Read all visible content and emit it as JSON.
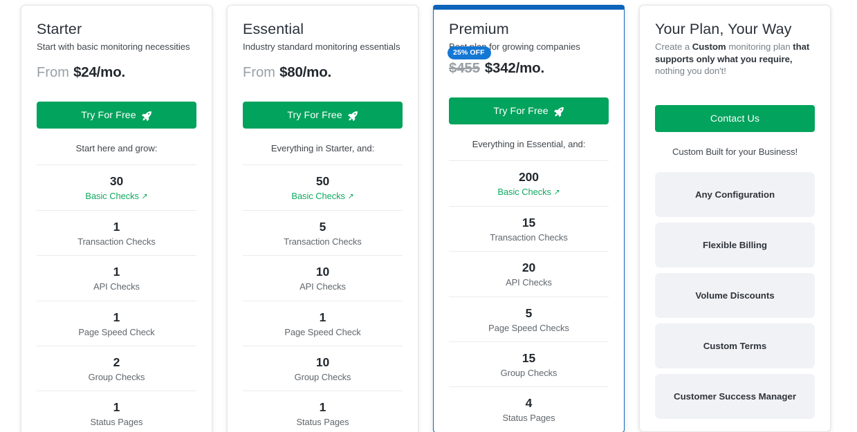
{
  "colors": {
    "cta_green": "#02a35c",
    "link_green": "#0fa960",
    "badge_blue": "#1477d4",
    "featured_border": "#0b63bb",
    "pill_background": "#f1f2f6"
  },
  "plans": [
    {
      "name": "Starter",
      "tagline": "Start with basic monitoring necessities",
      "price_prefix": "From",
      "price": "$24/mo.",
      "old_price": "",
      "badge": "",
      "cta_label": "Try For Free",
      "cta_icon": "rocket-icon",
      "sub_note": "Start here and grow:",
      "featured": false,
      "features": [
        {
          "value": "30",
          "label": "Basic Checks",
          "link": true,
          "arrow": "↗"
        },
        {
          "value": "1",
          "label": "Transaction Checks",
          "link": false
        },
        {
          "value": "1",
          "label": "API Checks",
          "link": false
        },
        {
          "value": "1",
          "label": "Page Speed Check",
          "link": false
        },
        {
          "value": "2",
          "label": "Group Checks",
          "link": false
        },
        {
          "value": "1",
          "label": "Status Pages",
          "link": false
        }
      ]
    },
    {
      "name": "Essential",
      "tagline": "Industry standard monitoring essentials",
      "price_prefix": "From",
      "price": "$80/mo.",
      "old_price": "",
      "badge": "",
      "cta_label": "Try For Free",
      "cta_icon": "rocket-icon",
      "sub_note": "Everything in Starter, and:",
      "featured": false,
      "features": [
        {
          "value": "50",
          "label": "Basic Checks",
          "link": true,
          "arrow": "↗"
        },
        {
          "value": "5",
          "label": "Transaction Checks",
          "link": false
        },
        {
          "value": "10",
          "label": "API Checks",
          "link": false
        },
        {
          "value": "1",
          "label": "Page Speed Check",
          "link": false
        },
        {
          "value": "10",
          "label": "Group Checks",
          "link": false
        },
        {
          "value": "1",
          "label": "Status Pages",
          "link": false
        }
      ]
    },
    {
      "name": "Premium",
      "tagline": "Best plan for growing companies",
      "price_prefix": "",
      "price": "$342/mo.",
      "old_price": "$455",
      "badge": "25% OFF",
      "cta_label": "Try For Free",
      "cta_icon": "rocket-icon",
      "sub_note": "Everything in Essential, and:",
      "featured": true,
      "features": [
        {
          "value": "200",
          "label": "Basic Checks",
          "link": true,
          "arrow": "↗"
        },
        {
          "value": "15",
          "label": "Transaction Checks",
          "link": false
        },
        {
          "value": "20",
          "label": "API Checks",
          "link": false
        },
        {
          "value": "5",
          "label": "Page Speed Checks",
          "link": false
        },
        {
          "value": "15",
          "label": "Group Checks",
          "link": false
        },
        {
          "value": "4",
          "label": "Status Pages",
          "link": false
        }
      ]
    }
  ],
  "custom_plan": {
    "name": "Your Plan, Your Way",
    "tagline_part1": "Create a ",
    "tagline_bold1": "Custom",
    "tagline_part2": " monitoring plan ",
    "tagline_bold2": "that supports only what you require,",
    "tagline_part3": " nothing you don't!",
    "cta_label": "Contact Us",
    "sub_note": "Custom Built for your Business!",
    "pills": [
      {
        "label": "Any Configuration"
      },
      {
        "label": "Flexible Billing"
      },
      {
        "label": "Volume Discounts"
      },
      {
        "label": "Custom Terms"
      },
      {
        "label": "Customer Success Manager"
      }
    ]
  }
}
